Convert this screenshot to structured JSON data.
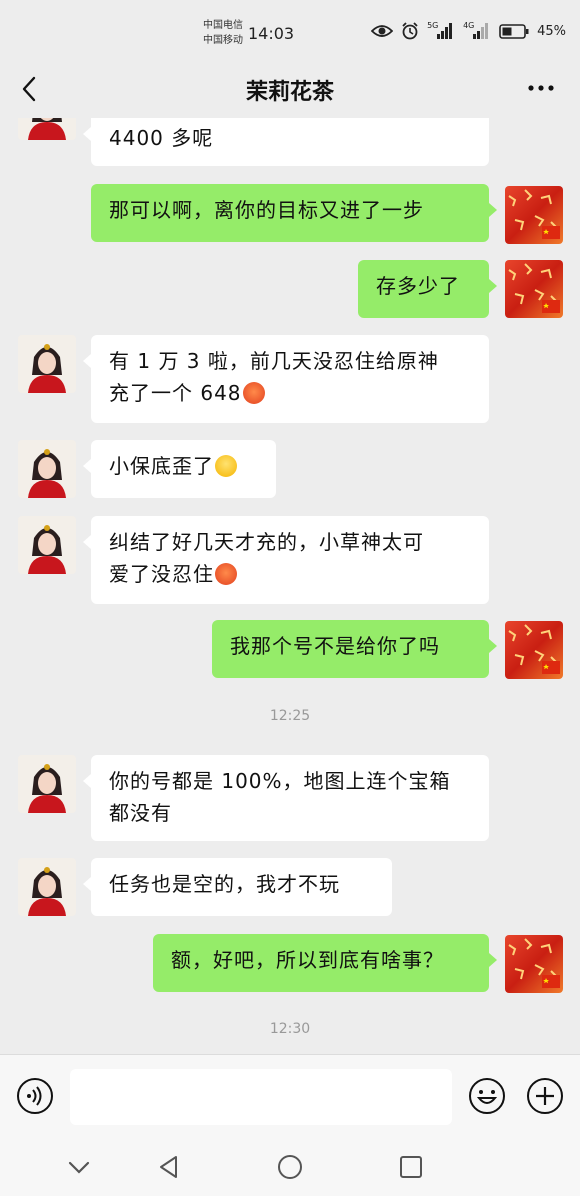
{
  "status_bar": {
    "carrier_1": "中国电信",
    "carrier_2": "中国移动",
    "time": "14:03",
    "battery": "45%",
    "signal_1": "5G",
    "signal_2": "4G"
  },
  "header": {
    "title": "茉莉花茶"
  },
  "messages": [
    {
      "side": "in",
      "text": "4400 多呢"
    },
    {
      "side": "out",
      "text": "那可以啊，离你的目标又进了一步"
    },
    {
      "side": "out",
      "text": "存多少了"
    },
    {
      "side": "in",
      "line1": "有 1 万 3 啦，前几天没忍住给原神",
      "line2": "充了一个 648",
      "emoji": "flushed-face-emoji"
    },
    {
      "side": "in",
      "text": "小保底歪了",
      "emoji": "crying-face-emoji"
    },
    {
      "side": "in",
      "line1": "纠结了好几天才充的，小草神太可",
      "line2": "爱了没忍住",
      "emoji": "flushed-face-emoji"
    },
    {
      "side": "out",
      "text": "我那个号不是给你了吗"
    },
    {
      "side": "in",
      "line1": "你的号都是 100%，地图上连个宝箱",
      "line2": "都没有"
    },
    {
      "side": "in",
      "text": "任务也是空的，我才不玩"
    },
    {
      "side": "out",
      "text": "额，好吧，所以到底有啥事？"
    }
  ],
  "timestamps": [
    "12:25",
    "12:30"
  ],
  "input_bar": {
    "text": ""
  },
  "colors": {
    "background": "#ededed",
    "outgoing_bubble": "#95ec69",
    "incoming_bubble": "#ffffff"
  }
}
